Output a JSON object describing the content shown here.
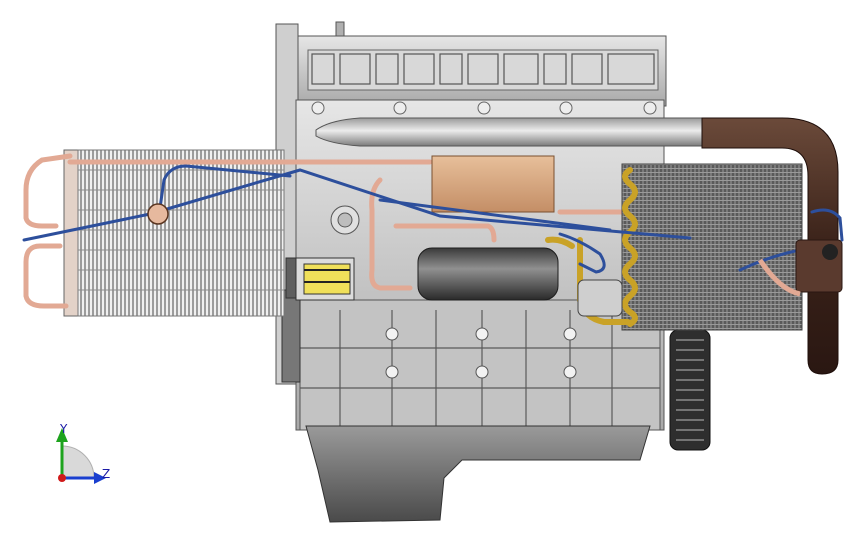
{
  "viewport": {
    "background": "#ffffff",
    "model_colors": {
      "block": "#c9c9c9",
      "block_dark": "#8e8e8e",
      "radiator_fin": "#d5d5d5",
      "copper_pipe": "#e8b39a",
      "blue_pipe": "#2d4f9c",
      "exhaust_pipe": "#4a2e24",
      "tank": "#d4a27c",
      "coil": "#c9a227"
    }
  },
  "triad": {
    "y_label": "Y",
    "z_label": "Z",
    "y_color": "#1ea31e",
    "z_color": "#1a3fcf",
    "x_color": "#d01a1a"
  }
}
